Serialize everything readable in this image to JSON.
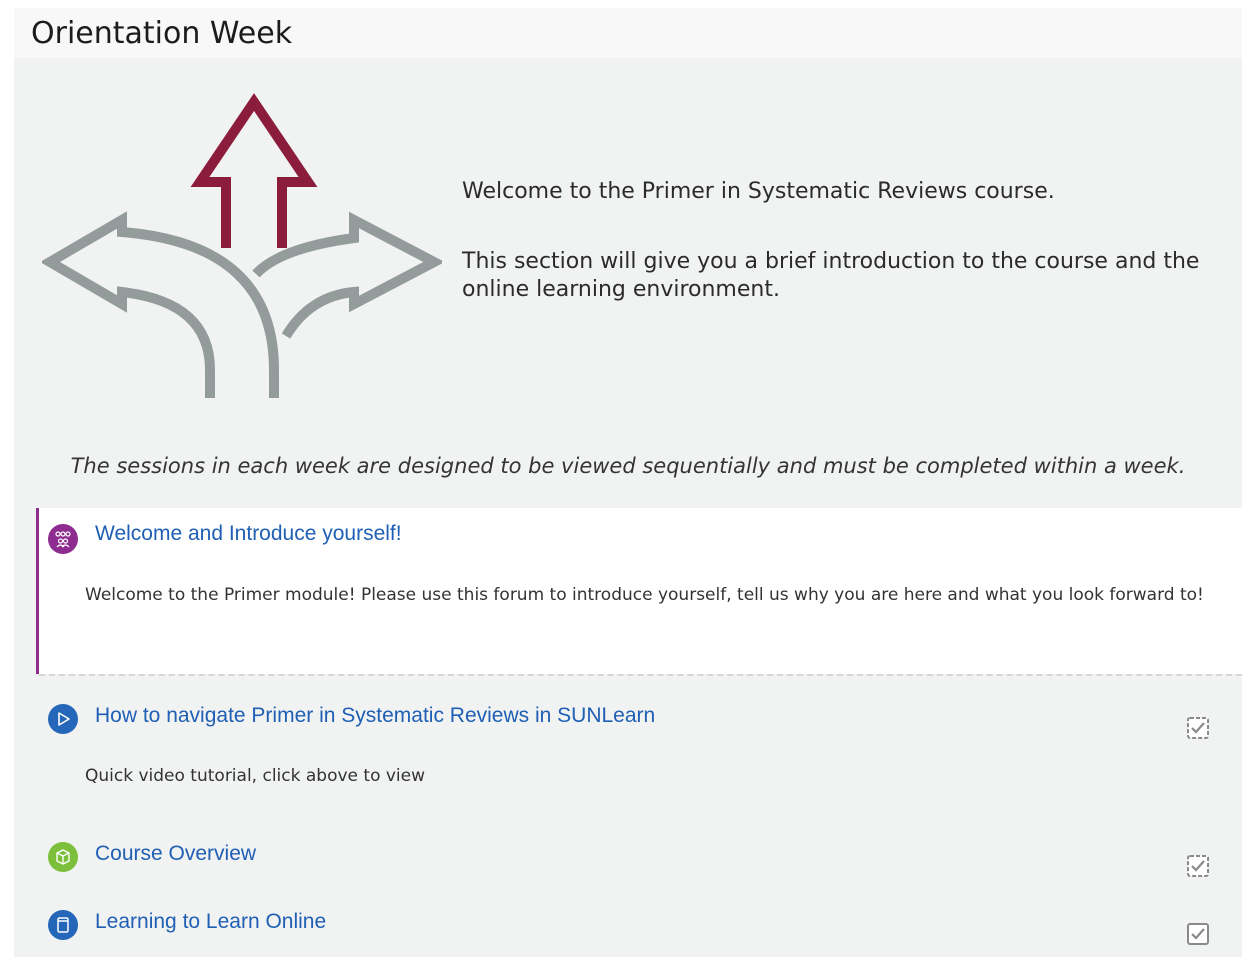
{
  "section": {
    "title": "Orientation Week",
    "intro_lines": [
      "Welcome to the Primer in Systematic Reviews course.",
      "This section will give you a brief introduction to the course and the online learning environment."
    ],
    "sequential_note": "The sessions in each week are designed to be viewed sequentially and must be completed within a week."
  },
  "activities": [
    {
      "title": "Welcome and Introduce yourself!",
      "icon": "forum-icon",
      "icon_color": "#8e2d8f",
      "description": "Welcome to the Primer module!  Please use this forum to introduce yourself, tell us why you are here and what you look forward to!",
      "highlighted": true
    },
    {
      "title": "How to navigate Primer in Systematic Reviews in SUNLearn",
      "icon": "play-icon",
      "icon_color": "#2466b8",
      "description": "Quick video tutorial, click above to view",
      "completion": "checkbox"
    },
    {
      "title": "Course Overview",
      "icon": "package-icon",
      "icon_color": "#7cbf3a",
      "completion": "checkbox"
    },
    {
      "title": "Learning to Learn Online",
      "icon": "book-icon",
      "icon_color": "#2466b8",
      "completion": "checkbox"
    }
  ],
  "colors": {
    "arrow_up": "#8b1c3c",
    "arrow_side": "#939b9b",
    "link": "#1f5fb4",
    "background": "#f1f2f2"
  }
}
